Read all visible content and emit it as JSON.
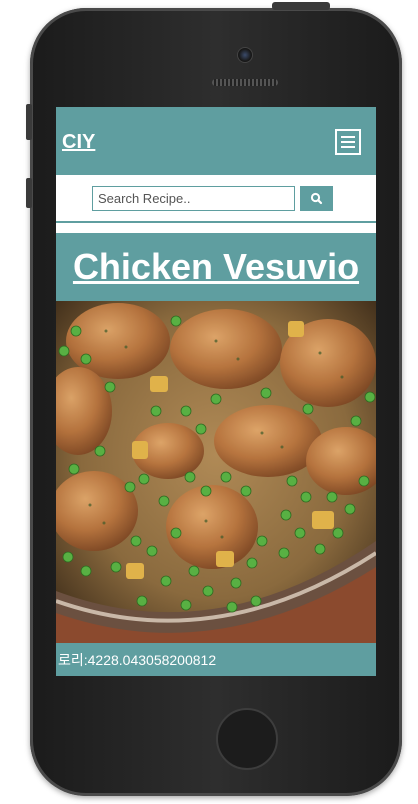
{
  "header": {
    "brand": "CIY",
    "menu_icon": "hamburger-menu-icon"
  },
  "search": {
    "placeholder": "Search Recipe..",
    "value": "",
    "button_icon": "search-icon"
  },
  "recipe": {
    "title": "Chicken Vesuvio"
  },
  "footer": {
    "text": "로리:4228.043058200812"
  },
  "colors": {
    "accent": "#5f9ea0",
    "device": "#1f1f1f"
  }
}
